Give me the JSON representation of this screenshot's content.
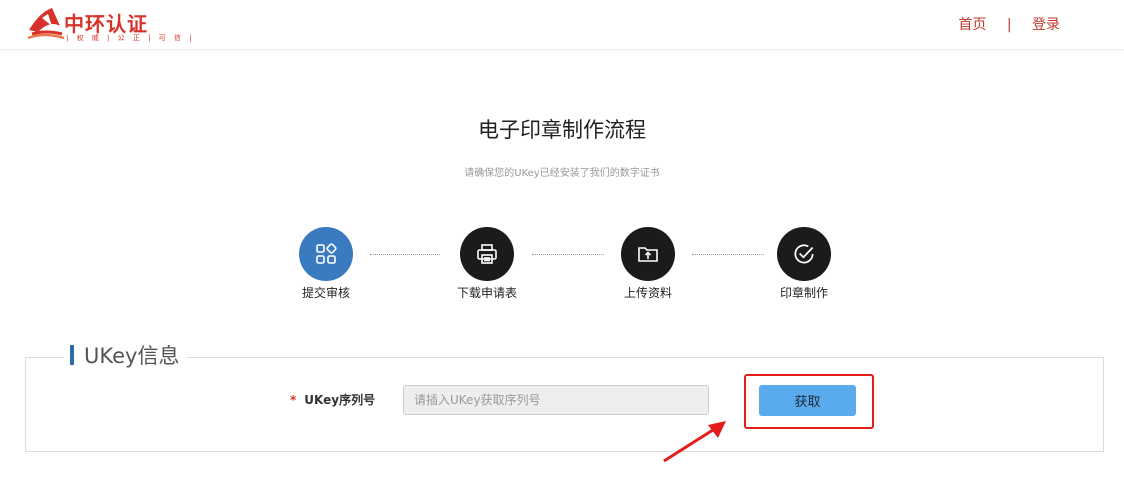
{
  "brand": {
    "name": "中环认证",
    "slogan": "| 权 威 | 公 正 | 可 信 |",
    "logo_icon": "triangle-swoosh-logo-icon",
    "color": "#d8322a"
  },
  "nav": {
    "home": "首页",
    "separator": "|",
    "login": "登录"
  },
  "page": {
    "title": "电子印章制作流程",
    "subtitle": "请确保您的UKey已经安装了我们的数字证书"
  },
  "steps": [
    {
      "label": "提交审核",
      "icon": "grid-apps-icon",
      "active": true
    },
    {
      "label": "下载申请表",
      "icon": "printer-icon",
      "active": false
    },
    {
      "label": "上传资料",
      "icon": "folder-upload-icon",
      "active": false
    },
    {
      "label": "印章制作",
      "icon": "check-circle-icon",
      "active": false
    }
  ],
  "colors": {
    "active_step": "#3a7bbf",
    "inactive_step": "#1b1b1b",
    "button": "#5aaaee",
    "highlight": "#e51c1c"
  },
  "ukey": {
    "section_title": "UKey信息",
    "required_mark": "*",
    "field_label": "UKey序列号",
    "input_value": "",
    "input_placeholder": "请插入UKey获取序列号",
    "fetch_button": "获取"
  }
}
